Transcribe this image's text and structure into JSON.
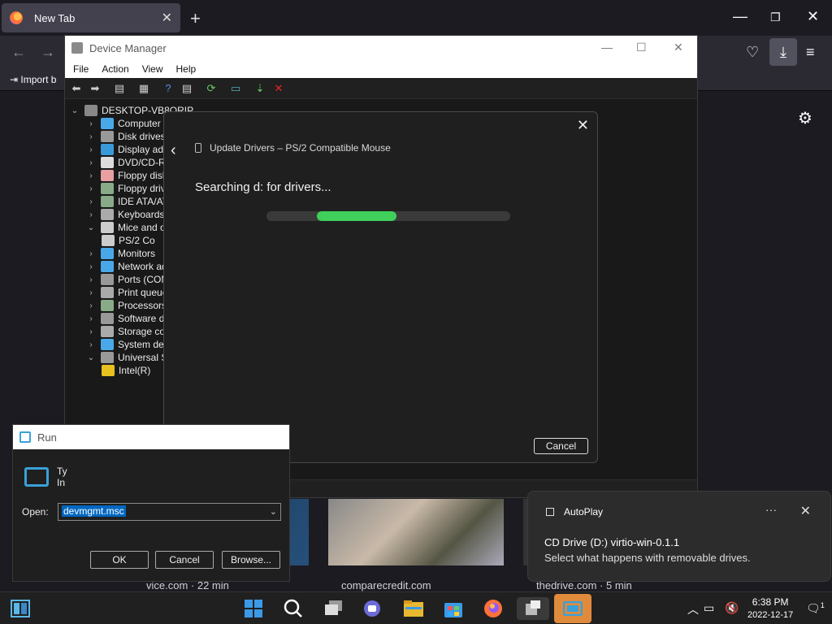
{
  "browser": {
    "tab_title": "New Tab",
    "import_label": "Import b",
    "new_tab_symbol": "+"
  },
  "news_cards": [
    {
      "source": "vice.com · 22 min"
    },
    {
      "source": "comparecredit.com"
    },
    {
      "source": "thedrive.com · 5 min"
    }
  ],
  "device_manager": {
    "title": "Device Manager",
    "menu": [
      "File",
      "Action",
      "View",
      "Help"
    ],
    "root": "DESKTOP-VB8ORIP",
    "tree": [
      {
        "label": "Computer",
        "indent": 1,
        "exp": "›",
        "color": "#4aa8e8"
      },
      {
        "label": "Disk drives",
        "indent": 1,
        "exp": "›",
        "color": "#999"
      },
      {
        "label": "Display ada",
        "indent": 1,
        "exp": "›",
        "color": "#3a9ad9"
      },
      {
        "label": "DVD/CD-RO",
        "indent": 1,
        "exp": "›",
        "color": "#ddd"
      },
      {
        "label": "Floppy disk",
        "indent": 1,
        "exp": "›",
        "color": "#e8a0a0"
      },
      {
        "label": "Floppy driv",
        "indent": 1,
        "exp": "›",
        "color": "#8a8"
      },
      {
        "label": "IDE ATA/AT",
        "indent": 1,
        "exp": "›",
        "color": "#8a8"
      },
      {
        "label": "Keyboards",
        "indent": 1,
        "exp": "›",
        "color": "#aaa"
      },
      {
        "label": "Mice and ot",
        "indent": 1,
        "exp": "⌄",
        "color": "#ccc"
      },
      {
        "label": "PS/2 Co",
        "indent": 2,
        "exp": "",
        "color": "#ccc"
      },
      {
        "label": "Monitors",
        "indent": 1,
        "exp": "›",
        "color": "#4aa8e8"
      },
      {
        "label": "Network ad",
        "indent": 1,
        "exp": "›",
        "color": "#4aa8e8"
      },
      {
        "label": "Ports (COM",
        "indent": 1,
        "exp": "›",
        "color": "#999"
      },
      {
        "label": "Print queue",
        "indent": 1,
        "exp": "›",
        "color": "#aaa"
      },
      {
        "label": "Processors",
        "indent": 1,
        "exp": "›",
        "color": "#8a8"
      },
      {
        "label": "Software de",
        "indent": 1,
        "exp": "›",
        "color": "#999"
      },
      {
        "label": "Storage cor",
        "indent": 1,
        "exp": "›",
        "color": "#aaa"
      },
      {
        "label": "System dev",
        "indent": 1,
        "exp": "›",
        "color": "#4aa8e8"
      },
      {
        "label": "Universal Se",
        "indent": 1,
        "exp": "⌄",
        "color": "#999"
      },
      {
        "label": "Intel(R)",
        "indent": 2,
        "exp": "",
        "color": "#e8c020"
      }
    ]
  },
  "update_dialog": {
    "title": "Update Drivers – PS/2 Compatible Mouse",
    "heading": "Searching d: for drivers...",
    "cancel_label": "Cancel",
    "progress_color": "#3fcf5a"
  },
  "run_dialog": {
    "title": "Run",
    "desc_line1": "Ty",
    "desc_line2": "In",
    "open_label": "Open:",
    "input_value": "devmgmt.msc",
    "ok_label": "OK",
    "cancel_label": "Cancel",
    "browse_label": "Browse..."
  },
  "toast": {
    "app": "AutoPlay",
    "heading": "CD Drive (D:) virtio-win-0.1.1",
    "body": "Select what happens with removable drives.",
    "more": "···"
  },
  "taskbar": {
    "time": "6:38 PM",
    "date": "2022-12-17",
    "notification_count": "1"
  }
}
